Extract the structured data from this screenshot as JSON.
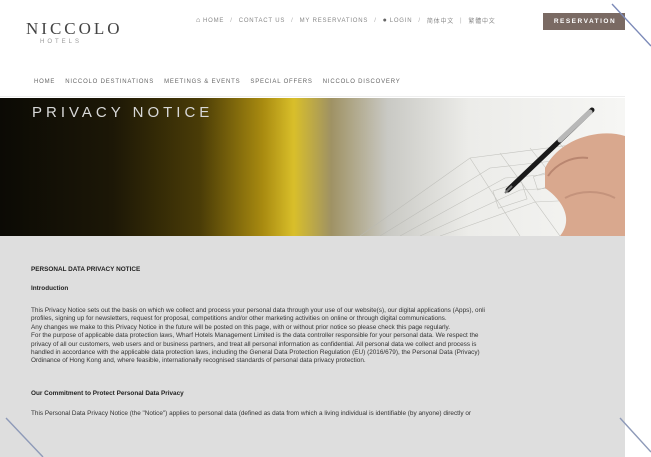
{
  "brand": {
    "name": "NICCOLO",
    "sub": "HOTELS"
  },
  "topnav": {
    "home": "HOME",
    "contact": "CONTACT US",
    "reservations": "MY RESERVATIONS",
    "login": "LOGIN",
    "lang1": "简体中文",
    "lang2": "繁體中文",
    "separator": "/",
    "lang_separator": "|",
    "home_icon": "home-icon",
    "user_icon": "user-icon"
  },
  "reservation_button": "RESERVATION",
  "mainnav": [
    "HOME",
    "NICCOLO DESTINATIONS",
    "MEETINGS & EVENTS",
    "SPECIAL OFFERS",
    "NICCOLO DISCOVERY"
  ],
  "hero": {
    "title": "PRIVACY NOTICE"
  },
  "content": {
    "heading": "PERSONAL DATA PRIVACY NOTICE",
    "intro_heading": "Introduction",
    "intro_lines": [
      "This Privacy Notice sets out the basis on which we collect and process your personal data through your use of our website(s), our digital applications (Apps), onli",
      "profiles, signing up for newsletters, request for proposal, competitions and/or other marketing activities on online or through digital communications.",
      "Any changes we make to this Privacy Notice in the future will be posted on this page, with or without prior notice so please check this page regularly.",
      "For the purpose of applicable data protection laws, Wharf Hotels Management Limited  is the data controller responsible for your personal data. We respect the",
      "privacy of all our customers, web users and or business partners, and treat all personal information as confidential. All personal data we collect and process is",
      "handled in accordance with the applicable data protection laws, including the General Data Protection Regulation (EU) (2016/679), the Personal Data (Privacy)",
      "Ordinance of Hong Kong and, where feasible, internationally recognised standards of personal data privacy protection."
    ],
    "commitment_heading": "Our Commitment to Protect Personal Data Privacy",
    "commitment_line": "This Personal Data Privacy Notice (the \"Notice\") applies to personal data (defined as data from which a living individual is identifiable (by anyone) directly or"
  },
  "colors": {
    "reservation_bg": "#7a6a63",
    "content_bg": "#dedede",
    "hero_gold": "#d9bf2a"
  }
}
